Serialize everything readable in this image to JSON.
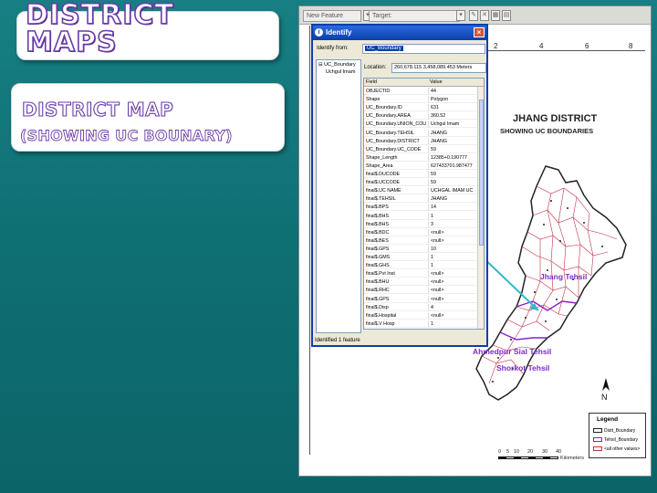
{
  "slide": {
    "title": "DISTRICT MAPS",
    "subtitle_line1": "DISTRICT MAP",
    "subtitle_line2": "(SHOWING UC BOUNARY)"
  },
  "toolbar": {
    "new_feature": "New Feature",
    "target": "Target:"
  },
  "ruler": {
    "ticks": [
      "2",
      "4",
      "6",
      "8"
    ]
  },
  "identify": {
    "title": "Identify",
    "close_label": "×",
    "identify_from_label": "Identify from:",
    "identify_from_value": "UC_Boundary",
    "tree_root": "UC_Boundary",
    "tree_child": "Uchgul Imam",
    "location_label": "Location:",
    "location_value": "260,678.115  3,458,089.453 Meters",
    "col_field": "Field",
    "col_value": "Value",
    "rows": [
      [
        "OBJECTID",
        "44"
      ],
      [
        "Shape",
        "Polygon"
      ],
      [
        "UC_Boundary.ID",
        "631"
      ],
      [
        "UC_Boundary.AREA",
        "360.52"
      ],
      [
        "UC_Boundary.UNION_COUN",
        "Uchgul Imam"
      ],
      [
        "UC_Boundary.TEHSIL",
        "JHANG"
      ],
      [
        "UC_Boundary.DISTRICT",
        "JHANG"
      ],
      [
        "UC_Boundary.UC_CODE",
        "59"
      ],
      [
        "Shape_Length",
        "12385+0.190777"
      ],
      [
        "Shape_Area",
        "627433701.987477"
      ],
      [
        "final$.DUCODE",
        "59"
      ],
      [
        "final$.UCCODE",
        "59"
      ],
      [
        "final$.UC NAME",
        "UCHGAL IMAM UC"
      ],
      [
        "final$.TEHSIL",
        "JHANG"
      ],
      [
        "final$.BPS",
        "14"
      ],
      [
        "final$.BHS",
        "1"
      ],
      [
        "final$.BHS",
        "3"
      ],
      [
        "final$.BDC",
        "<null>"
      ],
      [
        "final$.BES",
        "<null>"
      ],
      [
        "final$.GPS",
        "10"
      ],
      [
        "final$.GMS",
        "1"
      ],
      [
        "final$.GHS",
        "1"
      ],
      [
        "final$.Pvt Inst",
        "<null>"
      ],
      [
        "final$.BHU",
        "<null>"
      ],
      [
        "final$.RHC",
        "<null>"
      ],
      [
        "final$.GPS",
        "<null>"
      ],
      [
        "final$.Disp",
        "4"
      ],
      [
        "final$.Hospital",
        "<null>"
      ],
      [
        "final$.V Hosp",
        "1"
      ]
    ],
    "status": "Identified 1 feature"
  },
  "map": {
    "title": "JHANG DISTRICT",
    "subtitle": "SHOWING UC BOUNDARIES",
    "tehsils": [
      "Jhang Tehsil",
      "Ahmedpur Sial Tehsil",
      "Shorkot Tehsil"
    ],
    "north": "N",
    "legend_title": "Legend",
    "legend_items": [
      {
        "label": "Distt_Boundary",
        "color": "#222222"
      },
      {
        "label": "Tehsil_Boundary",
        "color": "#8b1fcf"
      },
      {
        "label": "<all other values>",
        "color": "#ffffff"
      }
    ],
    "scale_labels": [
      "0",
      "5",
      "10",
      "20",
      "30",
      "40"
    ],
    "scale_unit": "Kilometers"
  },
  "colors": {
    "background": "#0f7579",
    "title_outline": "#6a3aa8",
    "uc_boundary": "#c0314a",
    "tehsil_boundary": "#8b1fcf",
    "pointer": "#35b9c9"
  }
}
